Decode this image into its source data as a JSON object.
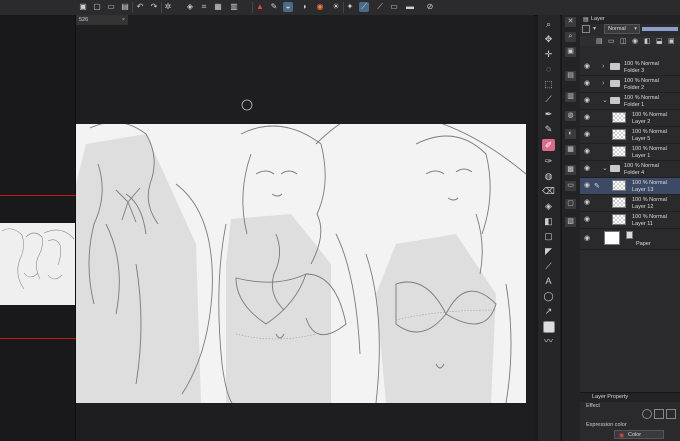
{
  "document": {
    "tab_label": "526",
    "close_glyph": "×"
  },
  "layer_panel": {
    "tab_label": "Layer",
    "blend_mode": "Normal",
    "layers": [
      {
        "opacity": "100 %",
        "mode": "Normal",
        "name": "Folder 3",
        "type": "folder"
      },
      {
        "opacity": "100 %",
        "mode": "Normal",
        "name": "Folder 2",
        "type": "folder"
      },
      {
        "opacity": "100 %",
        "mode": "Normal",
        "name": "Folder 1",
        "type": "folder"
      },
      {
        "opacity": "100 %",
        "mode": "Normal",
        "name": "Layer 2",
        "type": "layer"
      },
      {
        "opacity": "100 %",
        "mode": "Normal",
        "name": "Layer 5",
        "type": "layer"
      },
      {
        "opacity": "100 %",
        "mode": "Normal",
        "name": "Layer 1",
        "type": "layer"
      },
      {
        "opacity": "100 %",
        "mode": "Normal",
        "name": "Folder 4",
        "type": "folder"
      },
      {
        "opacity": "100 %",
        "mode": "Normal",
        "name": "Layer 13",
        "type": "layer",
        "selected": true
      },
      {
        "opacity": "100 %",
        "mode": "Normal",
        "name": "Layer 12",
        "type": "layer"
      },
      {
        "opacity": "100 %",
        "mode": "Normal",
        "name": "Layer 11",
        "type": "layer"
      }
    ],
    "paper_label": "Paper"
  },
  "layer_property": {
    "tab_label": "Layer Property",
    "effect_label": "Effect",
    "expression_label": "Expression color",
    "expression_value": "Color"
  },
  "colors": {
    "accent_selected": "#3c4a66",
    "active_tool": "#d86a8a",
    "guide_red": "#c01a1a"
  }
}
